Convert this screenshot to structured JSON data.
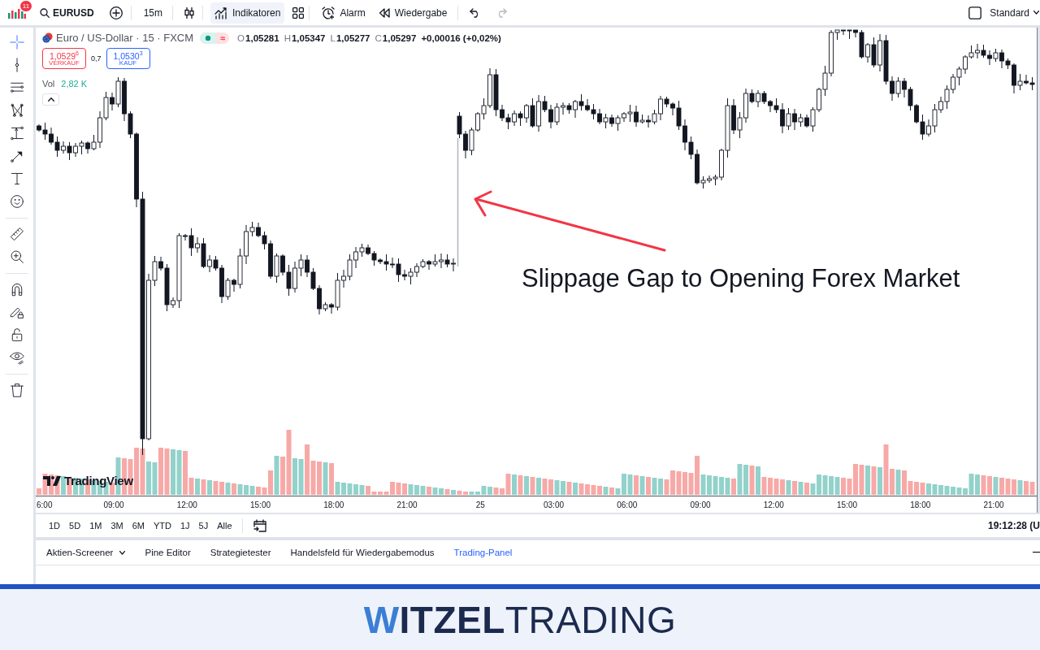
{
  "toolbar": {
    "notification_count": "11",
    "symbol": "EURUSD",
    "interval": "15m",
    "indicators": {
      "label": "Indikatoren",
      "highlighted": true
    },
    "alert": "Alarm",
    "replay": "Wiedergabe",
    "undo": {
      "disabled": false
    },
    "redo": {
      "disabled": true
    },
    "layout": "Standard"
  },
  "left_toolbar": {
    "groups": [
      {
        "tools": [
          {
            "kind": "crosshair",
            "selected": true
          },
          {
            "kind": "dot-line",
            "selected": false
          },
          {
            "kind": "parallel-lines",
            "selected": false
          },
          {
            "kind": "pattern",
            "selected": false
          },
          {
            "kind": "projection",
            "selected": false
          },
          {
            "kind": "trend-line",
            "selected": false
          },
          {
            "kind": "text",
            "selected": false
          },
          {
            "kind": "smiley",
            "selected": false
          }
        ]
      },
      {
        "tools": [
          {
            "kind": "ruler",
            "selected": false
          },
          {
            "kind": "zoom-in",
            "selected": false
          }
        ]
      },
      {
        "tools": [
          {
            "kind": "magnet",
            "selected": false
          },
          {
            "kind": "pencil-lock",
            "selected": false
          },
          {
            "kind": "unlock",
            "selected": false
          },
          {
            "kind": "eye",
            "selected": false
          }
        ]
      },
      {
        "tools": [
          {
            "kind": "trash",
            "selected": false
          }
        ]
      }
    ]
  },
  "legend": {
    "instrument": "Euro / US-Dollar · 15 · FXCM",
    "status_symbol": "≈",
    "ohlc": [
      {
        "label": "O",
        "value": "1,05281"
      },
      {
        "label": "H",
        "value": "1,05347"
      },
      {
        "label": "L",
        "value": "1,05277"
      },
      {
        "label": "C",
        "value": "1,05297"
      }
    ],
    "change": "+0,00016 (+0,02%)",
    "sell": {
      "price": "1,0529$^{6}$",
      "label": "VERKAUF"
    },
    "spread": "0,7",
    "buy": {
      "price": "1,0530$^{3}$",
      "label": "KAUF"
    },
    "volume": {
      "label": "Vol",
      "value": "2,82 K"
    }
  },
  "chart": {
    "logo_text": "TradingView",
    "annotation": "Slippage Gap to Opening Forex Market",
    "time_labels": [
      "6:00",
      "09:00",
      "12:00",
      "15:00",
      "18:00",
      "21:00",
      "25",
      "03:00",
      "06:00",
      "09:00",
      "12:00",
      "15:00",
      "18:00",
      "21:00"
    ]
  },
  "range_bar": {
    "ranges": [
      "1D",
      "5D",
      "1M",
      "3M",
      "6M",
      "YTD",
      "1J",
      "5J",
      "Alle"
    ],
    "clock": "19:12:28 (U"
  },
  "bottom_tabs": [
    {
      "label": "Aktien-Screener",
      "selected": false,
      "has_menu": true
    },
    {
      "label": "Pine Editor",
      "selected": false,
      "has_menu": false
    },
    {
      "label": "Strategietester",
      "selected": false,
      "has_menu": false
    },
    {
      "label": "Handelsfeld für Wiedergabemodus",
      "selected": false,
      "has_menu": false
    },
    {
      "label": "Trading-Panel",
      "selected": true,
      "has_menu": false
    }
  ],
  "brand_banner": {
    "text": "**WITZEL**TRADING"
  }
}
